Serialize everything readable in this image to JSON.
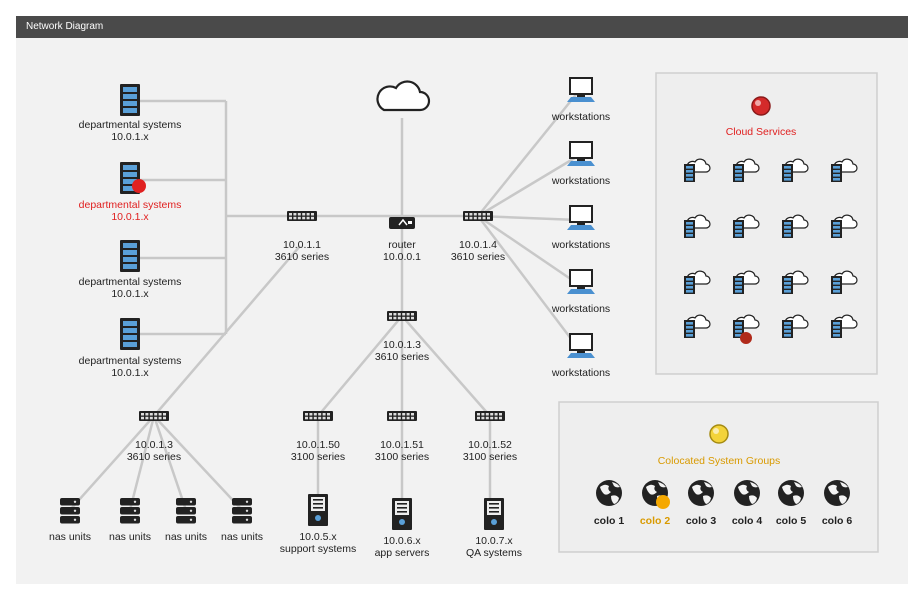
{
  "window": {
    "title": "Network Diagram"
  },
  "colors": {
    "alert": "#e02020",
    "warning": "#f5a800",
    "accent_red": "#e02020",
    "accent_yellow": "#d99a00"
  },
  "cloud": {
    "icon": "cloud-icon"
  },
  "router": {
    "name": "router",
    "ip": "10.0.0.1"
  },
  "switches": {
    "sw_left": {
      "ip": "10.0.1.1",
      "model": "3610 series"
    },
    "sw_right": {
      "ip": "10.0.1.4",
      "model": "3610 series"
    },
    "sw_mid": {
      "ip": "10.0.1.3",
      "model": "3610 series"
    },
    "sw_bl": {
      "ip": "10.0.1.3",
      "model": "3610 series"
    },
    "sw_50": {
      "ip": "10.0.1.50",
      "model": "3100 series"
    },
    "sw_51": {
      "ip": "10.0.1.51",
      "model": "3100 series"
    },
    "sw_52": {
      "ip": "10.0.1.52",
      "model": "3100 series"
    }
  },
  "departmental": [
    {
      "name": "departmental systems",
      "ip": "10.0.1.x",
      "alert": false
    },
    {
      "name": "departmental systems",
      "ip": "10.0.1.x",
      "alert": true
    },
    {
      "name": "departmental systems",
      "ip": "10.0.1.x",
      "alert": false
    },
    {
      "name": "departmental systems",
      "ip": "10.0.1.x",
      "alert": false
    }
  ],
  "workstations": [
    {
      "name": "workstations"
    },
    {
      "name": "workstations"
    },
    {
      "name": "workstations"
    },
    {
      "name": "workstations"
    },
    {
      "name": "workstations"
    }
  ],
  "nas": [
    {
      "name": "nas units"
    },
    {
      "name": "nas units"
    },
    {
      "name": "nas units"
    },
    {
      "name": "nas units"
    }
  ],
  "servers": [
    {
      "ip": "10.0.5.x",
      "name": "support systems"
    },
    {
      "ip": "10.0.6.x",
      "name": "app servers"
    },
    {
      "ip": "10.0.7.x",
      "name": "QA systems"
    }
  ],
  "cloud_services": {
    "title": "Cloud Services",
    "status": "red",
    "alert_index": 13,
    "count": 16
  },
  "colo": {
    "title": "Colocated System Groups",
    "status": "yellow",
    "items": [
      {
        "label": "colo 1",
        "warning": false
      },
      {
        "label": "colo 2",
        "warning": true
      },
      {
        "label": "colo 3",
        "warning": false
      },
      {
        "label": "colo 4",
        "warning": false
      },
      {
        "label": "colo 5",
        "warning": false
      },
      {
        "label": "colo 6",
        "warning": false
      }
    ]
  }
}
